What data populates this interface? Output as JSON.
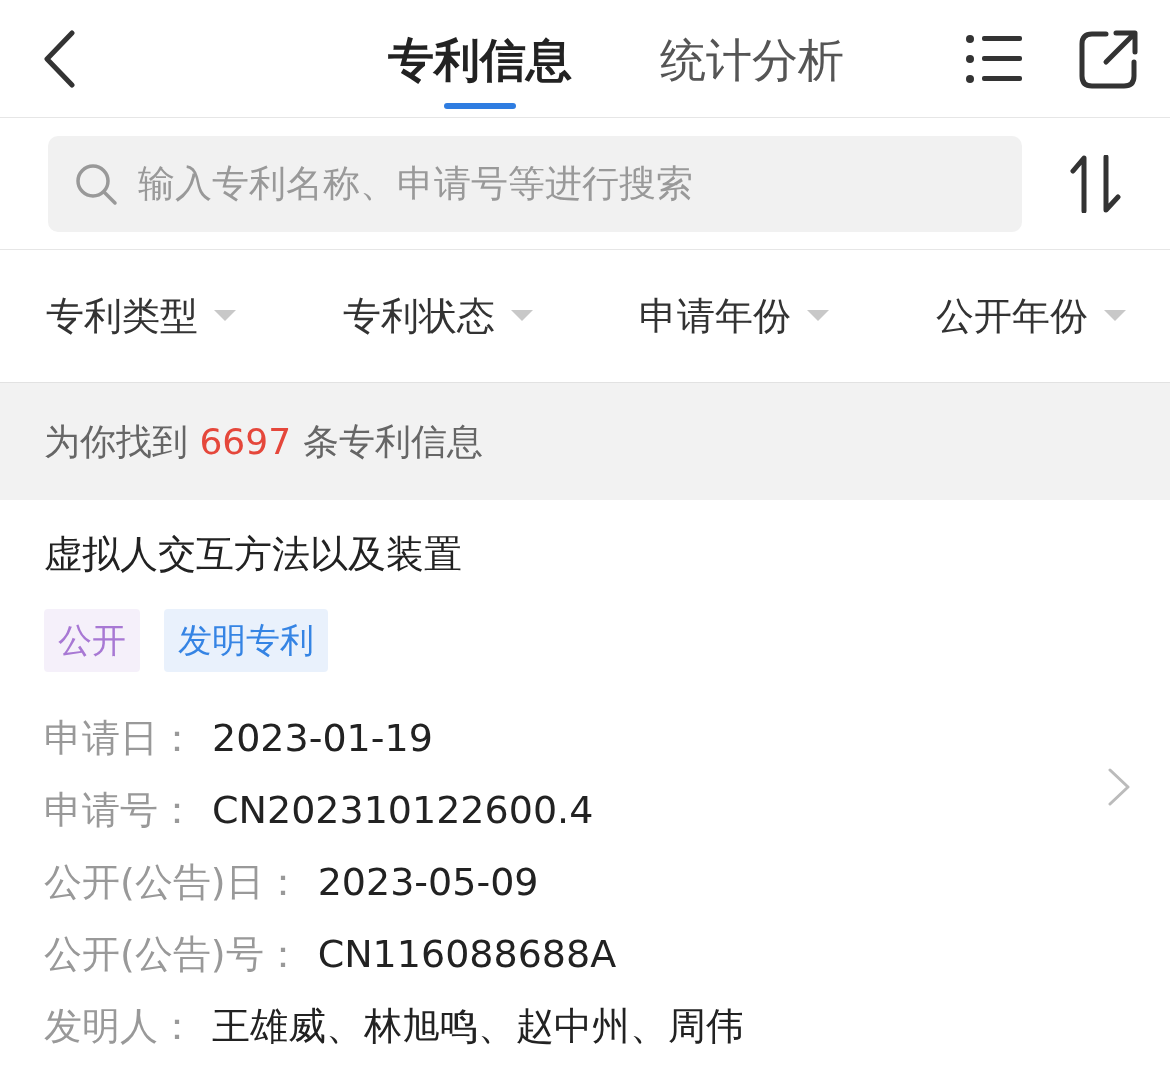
{
  "header": {
    "tabs": [
      {
        "label": "专利信息",
        "selected": true
      },
      {
        "label": "统计分析",
        "selected": false
      }
    ]
  },
  "search": {
    "placeholder": "输入专利名称、申请号等进行搜索"
  },
  "filters": [
    {
      "label": "专利类型"
    },
    {
      "label": "专利状态"
    },
    {
      "label": "申请年份"
    },
    {
      "label": "公开年份"
    }
  ],
  "result_summary": {
    "prefix": "为你找到",
    "count": "6697",
    "suffix": "条专利信息"
  },
  "patents": [
    {
      "title": "虚拟人交互方法以及装置",
      "tags": [
        {
          "label": "公开",
          "color": "#a878d4"
        },
        {
          "label": "发明专利",
          "color": "#3584e4"
        }
      ],
      "fields": [
        {
          "label": "申请日：",
          "value": "2023-01-19"
        },
        {
          "label": "申请号：",
          "value": "CN202310122600.4"
        },
        {
          "label": "公开(公告)日：",
          "value": "2023-05-09"
        },
        {
          "label": "公开(公告)号：",
          "value": "CN116088688A"
        },
        {
          "label": "发明人：",
          "value": "王雄威、林旭鸣、赵中州、周伟"
        }
      ]
    }
  ]
}
